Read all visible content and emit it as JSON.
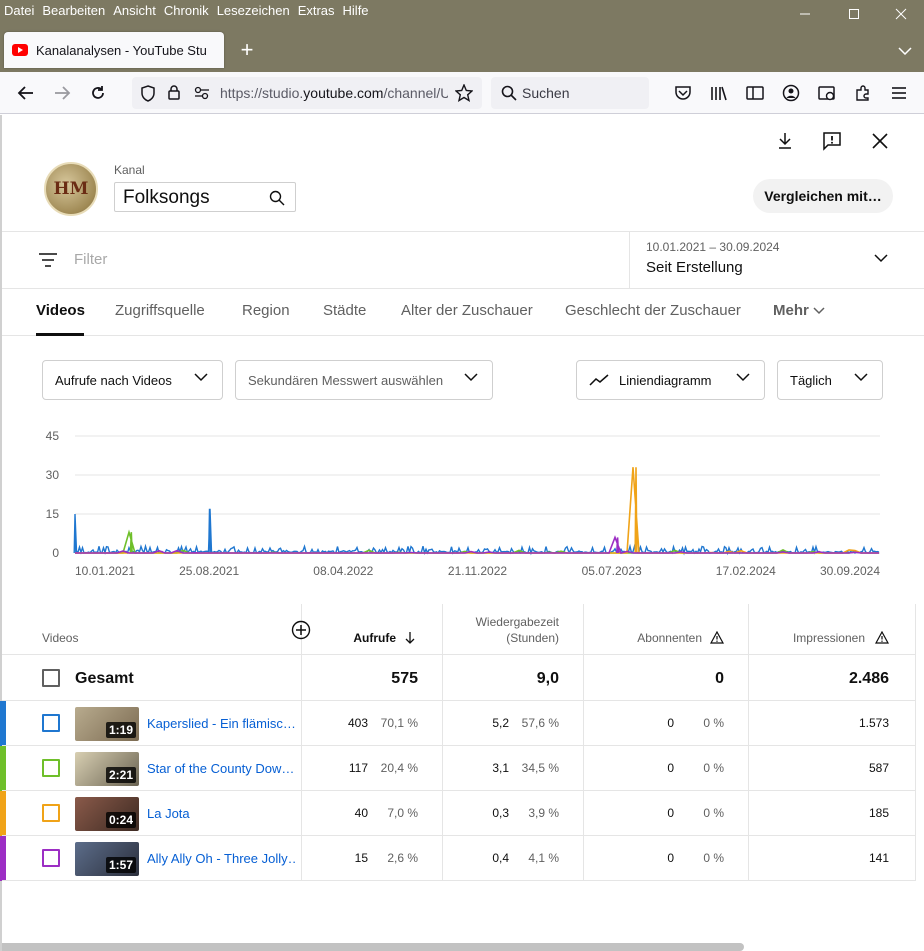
{
  "menu": [
    "Datei",
    "Bearbeiten",
    "Ansicht",
    "Chronik",
    "Lesezeichen",
    "Extras",
    "Hilfe"
  ],
  "tab_title": "Kanalanalysen - YouTube Studio",
  "url": {
    "prefix": "https://studio.",
    "host": "youtube.com",
    "path": "/channel/U"
  },
  "search_label": "Suchen",
  "kanal_label": "Kanal",
  "channel_name": "Folksongs",
  "avatar_text": "HM",
  "compare_label": "Vergleichen mit…",
  "filter_placeholder": "Filter",
  "date_range": "10.01.2021 – 30.09.2024",
  "date_label": "Seit Erstellung",
  "tabs": [
    "Videos",
    "Zugriffsquelle",
    "Region",
    "Städte",
    "Alter der Zuschauer",
    "Geschlecht der Zuschauer",
    "Mehr"
  ],
  "dropdowns": {
    "metric": "Aufrufe nach Videos",
    "secondary": "Sekundären Messwert auswählen",
    "chart_type": "Liniendiagramm",
    "interval": "Täglich"
  },
  "colors": {
    "blue": "#1f77d0",
    "green": "#6fbf2a",
    "orange": "#f0a318",
    "purple": "#9c2ec4"
  },
  "chart_data": {
    "type": "line",
    "x_labels": [
      "10.01.2021",
      "25.08.2021",
      "08.04.2022",
      "21.11.2022",
      "05.07.2023",
      "17.02.2024",
      "30.09.2024"
    ],
    "y_ticks": [
      0,
      15,
      30,
      45
    ],
    "ylim": [
      0,
      45
    ],
    "series": [
      {
        "name": "Kaperslied - Ein flämisc…",
        "color": "#1f77d0",
        "spikes": [
          {
            "x": "10.01.2021",
            "y": 15
          },
          {
            "x": "25.08.2021",
            "y": 17
          }
        ]
      },
      {
        "name": "Star of the County Dow…",
        "color": "#6fbf2a",
        "spikes": [
          {
            "x": "2021-04",
            "y": 8
          }
        ]
      },
      {
        "name": "La Jota",
        "color": "#f0a318",
        "spikes": [
          {
            "x": "2023-08",
            "y": 33
          }
        ]
      },
      {
        "name": "Ally Ally Oh - Three Jolly…",
        "color": "#9c2ec4",
        "spikes": [
          {
            "x": "2023-07",
            "y": 6
          }
        ]
      }
    ]
  },
  "table": {
    "headers": {
      "videos": "Videos",
      "views": "Aufrufe",
      "watch_time_1": "Wiedergabezeit",
      "watch_time_2": "(Stunden)",
      "subs": "Abonnenten",
      "impressions": "Impressionen"
    },
    "total": {
      "label": "Gesamt",
      "views": "575",
      "watch": "9,0",
      "subs": "0",
      "impressions": "2.486"
    },
    "rows": [
      {
        "title": "Kaperslied - Ein flämisc…",
        "duration": "1:19",
        "views": "403",
        "views_pct": "70,1 %",
        "watch": "5,2",
        "watch_pct": "57,6 %",
        "subs": "0",
        "subs_pct": "0 %",
        "impressions": "1.573"
      },
      {
        "title": "Star of the County Dow…",
        "duration": "2:21",
        "views": "117",
        "views_pct": "20,4 %",
        "watch": "3,1",
        "watch_pct": "34,5 %",
        "subs": "0",
        "subs_pct": "0 %",
        "impressions": "587"
      },
      {
        "title": "La Jota",
        "duration": "0:24",
        "views": "40",
        "views_pct": "7,0 %",
        "watch": "0,3",
        "watch_pct": "3,9 %",
        "subs": "0",
        "subs_pct": "0 %",
        "impressions": "185"
      },
      {
        "title": "Ally Ally Oh - Three Jolly…",
        "duration": "1:57",
        "views": "15",
        "views_pct": "2,6 %",
        "watch": "0,4",
        "watch_pct": "4,1 %",
        "subs": "0",
        "subs_pct": "0 %",
        "impressions": "141"
      }
    ]
  }
}
